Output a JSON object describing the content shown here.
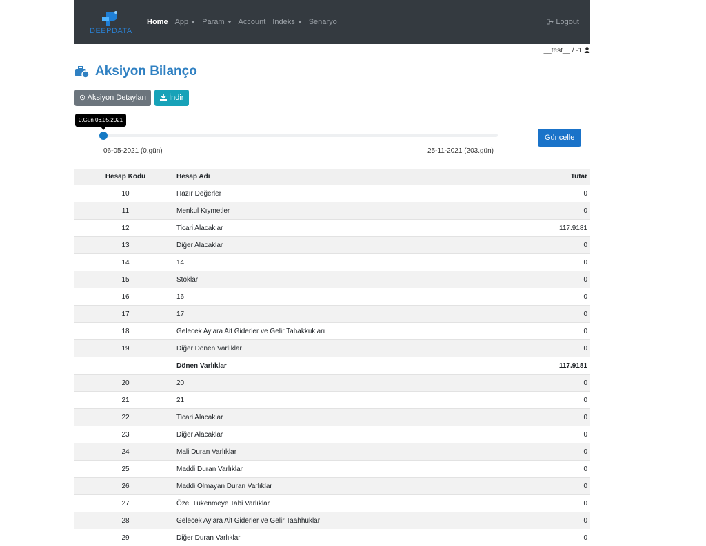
{
  "nav": {
    "logo_text": "DEEPDATA",
    "items": [
      {
        "label": "Home",
        "active": true,
        "dropdown": false
      },
      {
        "label": "App",
        "active": false,
        "dropdown": true
      },
      {
        "label": "Param",
        "active": false,
        "dropdown": true
      },
      {
        "label": "Account",
        "active": false,
        "dropdown": false
      },
      {
        "label": "Indeks",
        "active": false,
        "dropdown": true
      },
      {
        "label": "Senaryo",
        "active": false,
        "dropdown": false
      }
    ],
    "logout_label": "Logout"
  },
  "user_line": "__test__ / -1",
  "page_title": "Aksiyon Bilanço",
  "buttons": {
    "details": "Aksiyon Detayları",
    "download": "İndir",
    "update": "Güncelle"
  },
  "slider": {
    "tooltip": "0.Gün 06.05.2021",
    "start_label": "06-05-2021 (0.gün)",
    "end_label": "25-11-2021 (203.gün)",
    "value": 0,
    "min": 0,
    "max": 203
  },
  "table": {
    "headers": [
      "Hesap Kodu",
      "Hesap Adı",
      "Tutar"
    ],
    "rows": [
      {
        "code": "10",
        "name": "Hazır Değerler",
        "amount": "0"
      },
      {
        "code": "11",
        "name": "Menkul Kıymetler",
        "amount": "0"
      },
      {
        "code": "12",
        "name": "Ticari Alacaklar",
        "amount": "117.9181"
      },
      {
        "code": "13",
        "name": "Diğer Alacaklar",
        "amount": "0"
      },
      {
        "code": "14",
        "name": "14",
        "amount": "0"
      },
      {
        "code": "15",
        "name": "Stoklar",
        "amount": "0"
      },
      {
        "code": "16",
        "name": "16",
        "amount": "0"
      },
      {
        "code": "17",
        "name": "17",
        "amount": "0"
      },
      {
        "code": "18",
        "name": "Gelecek Aylara Ait Giderler ve Gelir Tahakkukları",
        "amount": "0"
      },
      {
        "code": "19",
        "name": "Diğer Dönen Varlıklar",
        "amount": "0"
      },
      {
        "code": "",
        "name": "Dönen Varlıklar",
        "amount": "117.9181",
        "bold": true
      },
      {
        "code": "20",
        "name": "20",
        "amount": "0"
      },
      {
        "code": "21",
        "name": "21",
        "amount": "0"
      },
      {
        "code": "22",
        "name": "Ticari Alacaklar",
        "amount": "0"
      },
      {
        "code": "23",
        "name": "Diğer Alacaklar",
        "amount": "0"
      },
      {
        "code": "24",
        "name": "Mali Duran Varlıklar",
        "amount": "0"
      },
      {
        "code": "25",
        "name": "Maddi Duran Varlıklar",
        "amount": "0"
      },
      {
        "code": "26",
        "name": "Maddi Olmayan Duran Varlıklar",
        "amount": "0"
      },
      {
        "code": "27",
        "name": "Özel Tükenmeye Tabi Varlıklar",
        "amount": "0"
      },
      {
        "code": "28",
        "name": "Gelecek Aylara Ait Giderler ve Gelir Taahhukları",
        "amount": "0"
      },
      {
        "code": "29",
        "name": "Diğer Duran Varlıklar",
        "amount": "0"
      }
    ]
  }
}
